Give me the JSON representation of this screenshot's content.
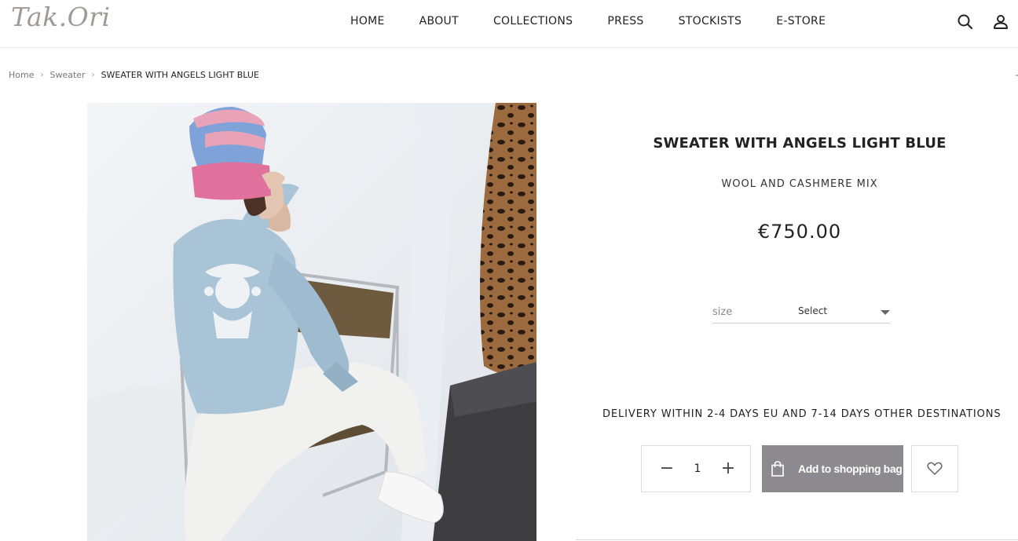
{
  "brand": {
    "logo_text": "Tak.Ori"
  },
  "nav": {
    "items": [
      {
        "label": "HOME"
      },
      {
        "label": "ABOUT"
      },
      {
        "label": "COLLECTIONS"
      },
      {
        "label": "PRESS"
      },
      {
        "label": "STOCKISTS"
      },
      {
        "label": "E-STORE"
      }
    ],
    "icons": [
      "search-icon",
      "user-icon"
    ]
  },
  "breadcrumb": {
    "items": [
      {
        "label": "Home"
      },
      {
        "label": "Sweater"
      },
      {
        "label": "SWEATER WITH ANGELS LIGHT BLUE"
      }
    ]
  },
  "product": {
    "title": "SWEATER WITH ANGELS LIGHT BLUE",
    "subtitle": "WOOL AND CASHMERE MIX",
    "price": "€750.00",
    "size": {
      "label": "size",
      "value": "Select"
    },
    "delivery": "DELIVERY WITHIN 2-4 DAYS EU AND 7-14 DAYS OTHER DESTINATIONS",
    "quantity": {
      "minus": "−",
      "value": "1",
      "plus": "+"
    },
    "add_to_bag_label": "Add to shopping bag",
    "image_alt": "Model wearing light blue sweater with angels print, striped pink and blue beanie, seated on a chair"
  },
  "colors": {
    "button_bg": "#8c8a8e",
    "logo": "#a09a94",
    "sweater": "#a9c4d6",
    "beanie_pink": "#e0709c",
    "beanie_blue": "#7fa3d8"
  }
}
